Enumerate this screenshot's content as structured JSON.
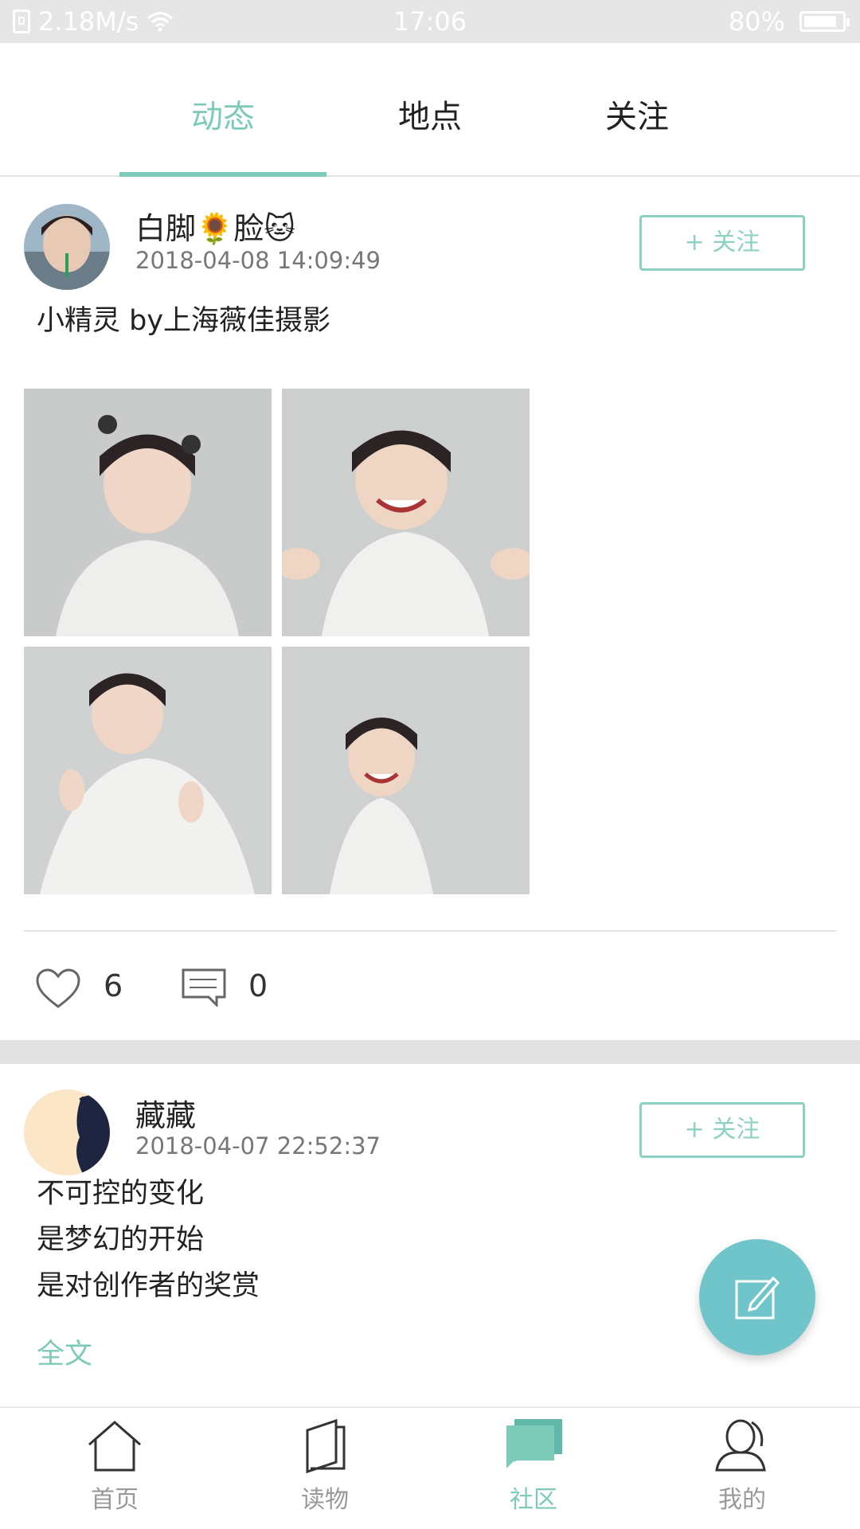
{
  "status_bar": {
    "speed": "2.18M/s",
    "time": "17:06",
    "battery": "80%"
  },
  "tabs": [
    {
      "label": "动态",
      "active": true
    },
    {
      "label": "地点",
      "active": false
    },
    {
      "label": "关注",
      "active": false
    }
  ],
  "posts": [
    {
      "username": "白脚🌻脸🐱",
      "time": "2018-04-08 14:09:49",
      "follow_label": "+ 关注",
      "text_lines": [
        "小精灵 by上海薇佳摄影"
      ],
      "photo_count": 4,
      "likes": "6",
      "comments": "0"
    },
    {
      "username": "藏藏",
      "time": "2018-04-07 22:52:37",
      "follow_label": "+ 关注",
      "text_lines": [
        "不可控的变化",
        "是梦幻的开始",
        "是对创作者的奖赏"
      ],
      "fulltext_label": "全文"
    }
  ],
  "bottom_nav": [
    {
      "label": "首页",
      "icon": "home-icon",
      "active": false
    },
    {
      "label": "读物",
      "icon": "book-icon",
      "active": false
    },
    {
      "label": "社区",
      "icon": "community-icon",
      "active": true
    },
    {
      "label": "我的",
      "icon": "profile-icon",
      "active": false
    }
  ],
  "colors": {
    "accent": "#7ecab9",
    "fab": "#6fc5c9"
  }
}
